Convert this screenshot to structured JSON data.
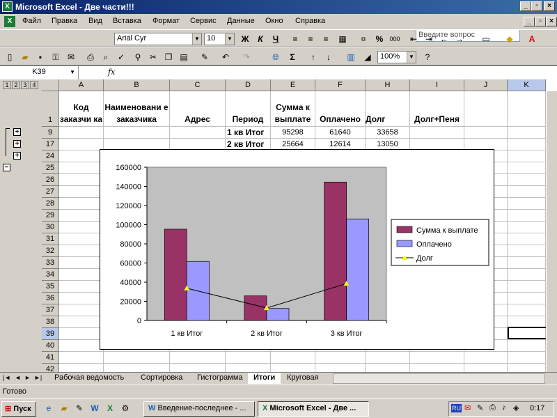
{
  "window": {
    "title": "Microsoft Excel - Две части!!!",
    "minimize": "_",
    "restore": "▫",
    "close": "×",
    "doc_minimize": "_",
    "doc_restore": "▫",
    "doc_close": "×"
  },
  "menu": [
    "Файл",
    "Правка",
    "Вид",
    "Вставка",
    "Формат",
    "Сервис",
    "Данные",
    "Окно",
    "Справка"
  ],
  "help": {
    "placeholder": "Введите вопрос"
  },
  "format": {
    "font": "Arial Cyr",
    "size": "10",
    "bold": "Ж",
    "italic": "К",
    "underline": "Ч",
    "percent": "%",
    "thousands": "000"
  },
  "standard": {
    "zoom": "100%"
  },
  "formula": {
    "cell": "K39",
    "fx": "fx",
    "value": ""
  },
  "outline_levels": [
    "1",
    "2",
    "3",
    "4"
  ],
  "columns": [
    "A",
    "B",
    "C",
    "D",
    "E",
    "F",
    "H",
    "I",
    "J",
    "K"
  ],
  "rows": [
    "1",
    "9",
    "17",
    "24",
    "25",
    "26",
    "27",
    "28",
    "29",
    "30",
    "31",
    "32",
    "33",
    "34",
    "35",
    "36",
    "37",
    "38",
    "39",
    "40",
    "41",
    "42"
  ],
  "headers": {
    "a": "Код заказчи ка",
    "b": "Наименовани е заказчика",
    "c": "Адрес",
    "d": "Период",
    "e": "Сумма к выплате",
    "f": "Оплачено",
    "h": "Долг",
    "i": "Долг+Пеня"
  },
  "data_rows": [
    {
      "period": "1 кв Итог",
      "sum": "95298",
      "paid": "61640",
      "debt": "33658"
    },
    {
      "period": "2 кв Итог",
      "sum": "25664",
      "paid": "12614",
      "debt": "13050"
    }
  ],
  "chart_data": {
    "type": "bar",
    "categories": [
      "1 кв Итог",
      "2 кв Итог",
      "3 кв Итог"
    ],
    "series": [
      {
        "name": "Сумма к выплате",
        "type": "bar",
        "color": "#993366",
        "values": [
          95298,
          25664,
          144500
        ]
      },
      {
        "name": "Оплачено",
        "type": "bar",
        "color": "#9999ff",
        "values": [
          61640,
          12614,
          106000
        ]
      },
      {
        "name": "Долг",
        "type": "line",
        "color": "#000000",
        "marker": "#ffff00",
        "values": [
          33658,
          13050,
          38500
        ]
      }
    ],
    "ylim": [
      0,
      160000
    ],
    "yticks": [
      "0",
      "20000",
      "40000",
      "60000",
      "80000",
      "100000",
      "120000",
      "140000",
      "160000"
    ],
    "plot_bg": "#c0c0c0",
    "legend": "right"
  },
  "sheets": [
    "Рабочая ведомость",
    "Сортировка",
    "Гистограмма",
    "Итоги",
    "Круговая"
  ],
  "active_sheet": "Итоги",
  "status": "Готово",
  "taskbar": {
    "start": "Пуск",
    "tasks": [
      "Введение-последнее - ...",
      "Microsoft Excel - Две ..."
    ],
    "lang": "RU",
    "clock": "0:17"
  }
}
